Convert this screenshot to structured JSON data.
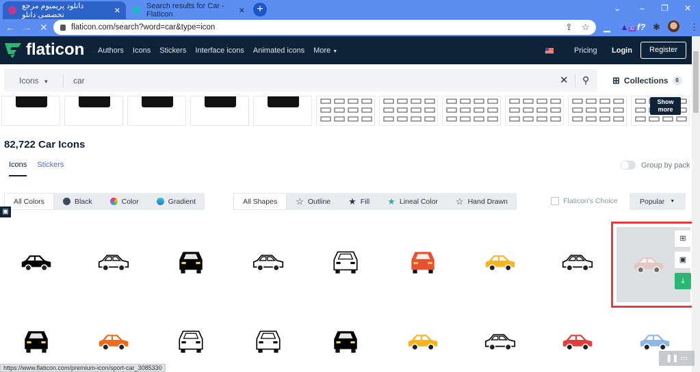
{
  "browser": {
    "tabs": [
      {
        "title": "دانلود پریمیوم مرجع تخصصی دانلو",
        "active": true
      },
      {
        "title": "Search results for Car - Flaticon",
        "active": false
      }
    ],
    "url": "flaticon.com/search?word=car&type=icon",
    "extension_badge": "32",
    "status_url": "https://www.flaticon.com/premium-icon/sport-car_3085330"
  },
  "nav": {
    "brand": "flaticon",
    "links": [
      "Authors",
      "Icons",
      "Stickers",
      "Interface icons",
      "Animated icons",
      "More"
    ],
    "pricing": "Pricing",
    "login": "Login",
    "register": "Register"
  },
  "search": {
    "type": "Icons",
    "query": "car",
    "collections": "Collections",
    "collections_count": "0"
  },
  "show_more": "Show more",
  "results": {
    "title": "82,722 Car Icons",
    "tabs": [
      "Icons",
      "Stickers"
    ],
    "group_by_pack": "Group by pack"
  },
  "filters": {
    "colors": [
      {
        "label": "All Colors",
        "active": true
      },
      {
        "label": "Black",
        "color": "#3c4a5a"
      },
      {
        "label": "Color",
        "color": "conic"
      },
      {
        "label": "Gradient",
        "color": "#2b8fd6"
      }
    ],
    "shapes": [
      {
        "label": "All Shapes",
        "active": true
      },
      {
        "label": "Outline",
        "icon": "star-outline"
      },
      {
        "label": "Fill",
        "icon": "star-fill"
      },
      {
        "label": "Lineal Color",
        "icon": "star-color"
      },
      {
        "label": "Hand Drawn",
        "icon": "star-outline"
      }
    ],
    "flaticons_choice": "Flaticon's Choice",
    "sort": "Popular"
  },
  "colors": {
    "nav_bg": "#0e2239",
    "accent_green": "#2cb673",
    "highlight": "#e43c3c",
    "browser_blue": "#5b8ef0"
  },
  "icons": [
    [
      {
        "v": "side",
        "fill": "#000"
      },
      {
        "v": "side-outline",
        "fill": "#000"
      },
      {
        "v": "front",
        "fill": "#000"
      },
      {
        "v": "side-outline",
        "fill": "#000"
      },
      {
        "v": "front-outline",
        "fill": "#000"
      },
      {
        "v": "front",
        "fill": "#e8512f"
      },
      {
        "v": "side",
        "fill": "#f6b51e"
      },
      {
        "v": "side-outline",
        "fill": "#000"
      },
      {
        "v": "side",
        "fill": "#e9b8b0"
      }
    ],
    [
      {
        "v": "front",
        "fill": "#000"
      },
      {
        "v": "side",
        "fill": "#f06a1c"
      },
      {
        "v": "front-outline",
        "fill": "#000"
      },
      {
        "v": "front-outline",
        "fill": "#000"
      },
      {
        "v": "front",
        "fill": "#000"
      },
      {
        "v": "side",
        "fill": "#f6b51e"
      },
      {
        "v": "side-outline",
        "fill": "#000"
      },
      {
        "v": "side",
        "fill": "#e23d3d"
      },
      {
        "v": "side",
        "fill": "#8fb8e8"
      }
    ]
  ]
}
